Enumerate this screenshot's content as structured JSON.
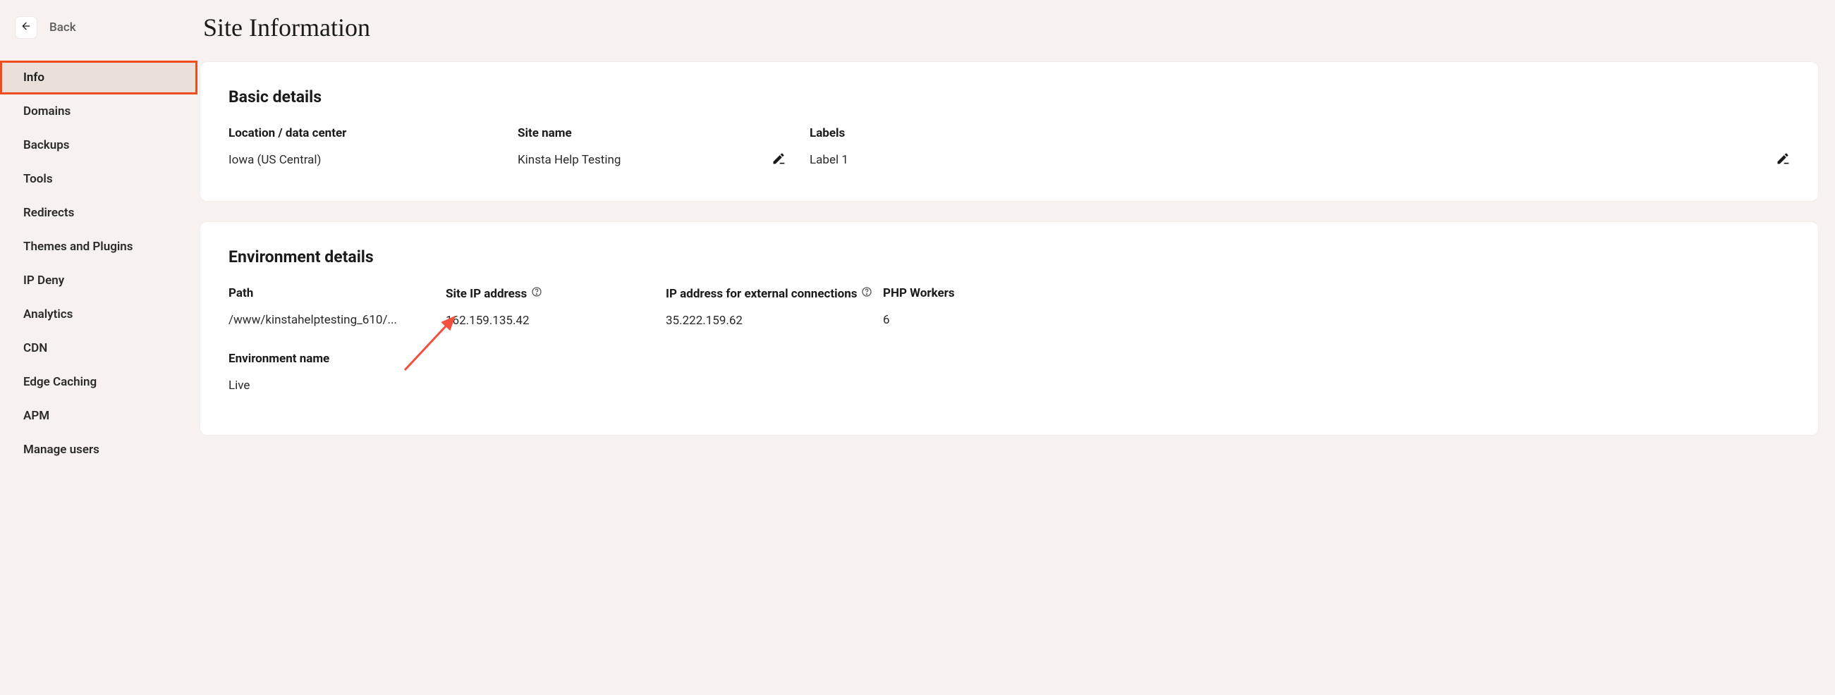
{
  "header": {
    "back_label": "Back",
    "title": "Site Information"
  },
  "sidebar": {
    "items": [
      {
        "label": "Info",
        "active": true
      },
      {
        "label": "Domains"
      },
      {
        "label": "Backups"
      },
      {
        "label": "Tools"
      },
      {
        "label": "Redirects"
      },
      {
        "label": "Themes and Plugins"
      },
      {
        "label": "IP Deny"
      },
      {
        "label": "Analytics"
      },
      {
        "label": "CDN"
      },
      {
        "label": "Edge Caching"
      },
      {
        "label": "APM"
      },
      {
        "label": "Manage users"
      }
    ]
  },
  "basic": {
    "heading": "Basic details",
    "location_label": "Location / data center",
    "location_value": "Iowa (US Central)",
    "site_name_label": "Site name",
    "site_name_value": "Kinsta Help Testing",
    "labels_label": "Labels",
    "labels_value": "Label 1"
  },
  "env": {
    "heading": "Environment details",
    "path_label": "Path",
    "path_value": "/www/kinstahelptesting_610/...",
    "site_ip_label": "Site IP address",
    "site_ip_value": "162.159.135.42",
    "ext_ip_label": "IP address for external connections",
    "ext_ip_value": "35.222.159.62",
    "php_label": "PHP Workers",
    "php_value": "6",
    "env_name_label": "Environment name",
    "env_name_value": "Live"
  },
  "annotation": {
    "highlight_item": "Info",
    "arrow_target": "Site IP address"
  }
}
